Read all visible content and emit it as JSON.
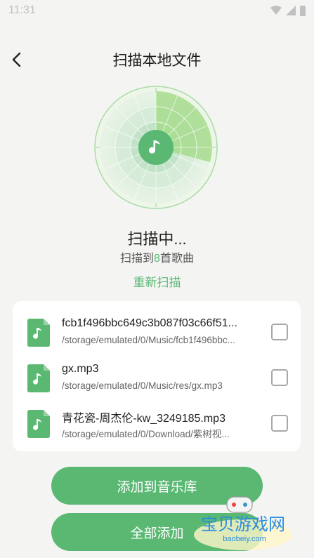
{
  "status_bar": {
    "time": "11:31"
  },
  "header": {
    "title": "扫描本地文件",
    "back_icon": "chevron-left-icon"
  },
  "scanner": {
    "status": "扫描中...",
    "count_prefix": "扫描到",
    "count": "8",
    "count_suffix": "首歌曲",
    "rescan_label": "重新扫描",
    "accent": "#5ab873"
  },
  "files": [
    {
      "name": "fcb1f496bbc649c3b087f03c66f51...",
      "path": "/storage/emulated/0/Music/fcb1f496bbc...",
      "checked": false
    },
    {
      "name": "gx.mp3",
      "path": "/storage/emulated/0/Music/res/gx.mp3",
      "checked": false
    },
    {
      "name": "青花瓷-周杰伦-kw_3249185.mp3",
      "path": "/storage/emulated/0/Download/紫树视...",
      "checked": false
    }
  ],
  "actions": {
    "add_to_library": "添加到音乐库",
    "add_all": "全部添加"
  },
  "watermark": {
    "title": "宝贝游戏网",
    "url": "baobeiy.com"
  }
}
